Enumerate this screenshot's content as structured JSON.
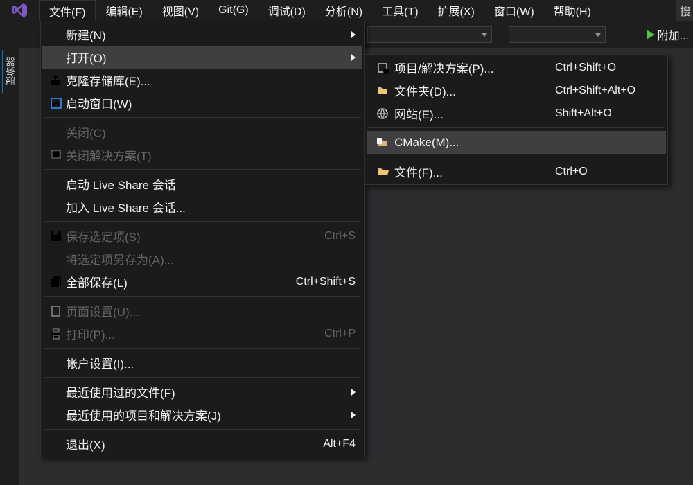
{
  "menubar": {
    "items": [
      "文件(F)",
      "编辑(E)",
      "视图(V)",
      "Git(G)",
      "调试(D)",
      "分析(N)",
      "工具(T)",
      "扩展(X)",
      "窗口(W)",
      "帮助(H)"
    ],
    "search_stub": "搜"
  },
  "toolbar": {
    "attach_label": "附加..."
  },
  "left_rail": {
    "tab": "服务器"
  },
  "file_menu": [
    {
      "label": "新建(N)",
      "icon": "",
      "arrow": true
    },
    {
      "label": "打开(O)",
      "icon": "",
      "arrow": true,
      "highlight": true
    },
    {
      "label": "克隆存储库(E)...",
      "icon": "clone"
    },
    {
      "label": "启动窗口(W)",
      "icon": "home"
    },
    {
      "sep": true
    },
    {
      "label": "关闭(C)",
      "disabled": true
    },
    {
      "label": "关闭解决方案(T)",
      "icon": "close-sln",
      "disabled": true
    },
    {
      "sep": true
    },
    {
      "label": "启动 Live Share 会话"
    },
    {
      "label": "加入 Live Share 会话..."
    },
    {
      "sep": true
    },
    {
      "label": "保存选定项(S)",
      "icon": "save",
      "shortcut": "Ctrl+S",
      "disabled": true
    },
    {
      "label": "将选定项另存为(A)...",
      "disabled": true
    },
    {
      "label": "全部保存(L)",
      "icon": "save-all",
      "shortcut": "Ctrl+Shift+S"
    },
    {
      "sep": true
    },
    {
      "label": "页面设置(U)...",
      "icon": "page",
      "disabled": true
    },
    {
      "label": "打印(P)...",
      "icon": "print",
      "shortcut": "Ctrl+P",
      "disabled": true
    },
    {
      "sep": true
    },
    {
      "label": "帐户设置(I)..."
    },
    {
      "sep": true
    },
    {
      "label": "最近使用过的文件(F)",
      "arrow": true
    },
    {
      "label": "最近使用的项目和解决方案(J)",
      "arrow": true
    },
    {
      "sep": true
    },
    {
      "label": "退出(X)",
      "shortcut": "Alt+F4"
    }
  ],
  "open_submenu": [
    {
      "label": "项目/解决方案(P)...",
      "icon": "project",
      "shortcut": "Ctrl+Shift+O"
    },
    {
      "label": "文件夹(D)...",
      "icon": "folder",
      "shortcut": "Ctrl+Shift+Alt+O"
    },
    {
      "label": "网站(E)...",
      "icon": "web",
      "shortcut": "Shift+Alt+O"
    },
    {
      "sep": true
    },
    {
      "label": "CMake(M)...",
      "icon": "cmake",
      "highlight": true
    },
    {
      "sep": true
    },
    {
      "label": "文件(F)...",
      "icon": "file-open",
      "shortcut": "Ctrl+O"
    }
  ]
}
